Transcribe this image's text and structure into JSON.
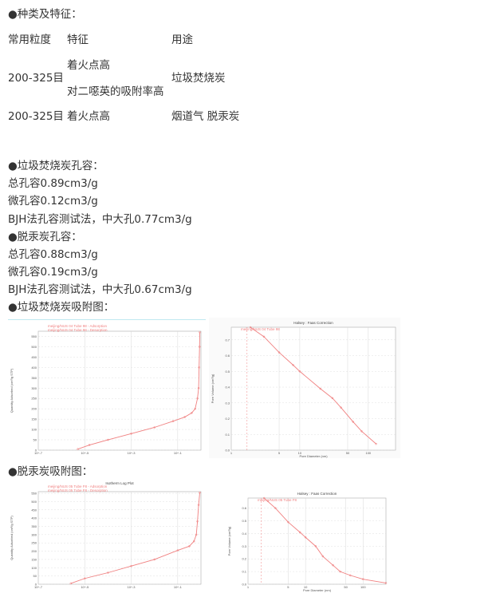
{
  "heading_types": "●种类及特征：",
  "table": {
    "headers": [
      "常用粒度",
      "特征",
      "用途"
    ],
    "rows": [
      {
        "size": "200-325目",
        "features": [
          "着火点高",
          "对二噁英的吸附率高"
        ],
        "use": "垃圾焚烧炭"
      },
      {
        "size": "200-325目",
        "features": [
          "着火点高"
        ],
        "use": "烟道气 脱汞炭"
      }
    ]
  },
  "section1": {
    "title": "●垃圾焚烧炭孔容：",
    "lines": [
      "总孔容0.89cm3/g",
      "微孔容0.12cm3/g",
      "BJH法孔容测试法，中大孔0.77cm3/g"
    ]
  },
  "section2": {
    "title": "●脱汞炭孔容：",
    "lines": [
      "总孔容0.88cm3/g",
      "微孔容0.19cm3/g",
      "BJH法孔容测试法，中大孔0.67cm3/g"
    ]
  },
  "heading_fig1": "●垃圾焚烧炭吸附图：",
  "heading_fig2": "●脱汞炭吸附图：",
  "colors": {
    "series": "#f08080",
    "grid": "#d8d8d8",
    "text": "#333333"
  },
  "figures": {
    "fig1_isotherm": {
      "type": "line",
      "legend": [
        "meijing/NUS 04 Tube 98 - Adsorption",
        "meijing/NUS 04 Tube 98 - Desorption"
      ],
      "ylabel": "Quantity Adsorbed (cm³/g STP)",
      "ylim": [
        0,
        575
      ],
      "yticks": [
        "0",
        "50",
        "100",
        "150",
        "200",
        "250",
        "300",
        "350",
        "400",
        "450",
        "500",
        "550"
      ],
      "xscale": "log",
      "xlim": [
        -7,
        0
      ],
      "points": [
        [
          -5.3,
          5
        ],
        [
          -4.8,
          25
        ],
        [
          -4,
          50
        ],
        [
          -3,
          80
        ],
        [
          -2,
          110
        ],
        [
          -1.2,
          140
        ],
        [
          -0.7,
          160
        ],
        [
          -0.4,
          180
        ],
        [
          -0.25,
          200
        ],
        [
          -0.15,
          250
        ],
        [
          -0.1,
          300
        ],
        [
          -0.08,
          400
        ],
        [
          -0.06,
          500
        ],
        [
          -0.05,
          570
        ]
      ]
    },
    "fig1_bjh": {
      "type": "line",
      "title": "Halsey : Faas Correction",
      "legend": [
        "meijing/NUS 04 Tube 98"
      ],
      "xlabel": "Pore Diameter (nm)",
      "ylabel": "Pore Volume (cm³/g)",
      "ylim": [
        0,
        0.78
      ],
      "yticks": [
        "0.0",
        "0.1",
        "0.2",
        "0.3",
        "0.4",
        "0.5",
        "0.6",
        "0.7"
      ],
      "xticks": [
        "1",
        "5",
        "10",
        "50",
        "100"
      ],
      "xscale": "log",
      "points": [
        [
          1.9,
          0.78
        ],
        [
          3,
          0.72
        ],
        [
          5,
          0.62
        ],
        [
          8,
          0.54
        ],
        [
          10,
          0.5
        ],
        [
          20,
          0.39
        ],
        [
          30,
          0.33
        ],
        [
          40,
          0.27
        ],
        [
          60,
          0.18
        ],
        [
          80,
          0.12
        ],
        [
          130,
          0.04
        ]
      ]
    },
    "fig2_isotherm": {
      "type": "line",
      "title": "Isotherm Log Plot",
      "legend": [
        "meijing/NUS 05 Tube F8 - Adsorption",
        "meijing/NUS 05 Tube F8 - Desorption"
      ],
      "ylabel": "Quantity Adsorbed (cm³/g STP)",
      "ylim": [
        0,
        560
      ],
      "yticks": [
        "0",
        "50",
        "100",
        "150",
        "200",
        "250",
        "300",
        "350",
        "400",
        "450",
        "500",
        "550"
      ],
      "xscale": "log",
      "xlim": [
        -7,
        0
      ],
      "points": [
        [
          -5.6,
          5
        ],
        [
          -5,
          35
        ],
        [
          -4,
          70
        ],
        [
          -3,
          110
        ],
        [
          -2,
          150
        ],
        [
          -1,
          205
        ],
        [
          -0.5,
          230
        ],
        [
          -0.3,
          260
        ],
        [
          -0.2,
          300
        ],
        [
          -0.15,
          380
        ],
        [
          -0.1,
          480
        ],
        [
          -0.05,
          555
        ]
      ]
    },
    "fig2_bjh": {
      "type": "line",
      "title": "Halsey : Faas Correction",
      "legend": [
        "meijing/NUS 05 Tube F8"
      ],
      "xlabel": "Pore Diameter (nm)",
      "ylabel": "Pore Volume (cm³/g)",
      "ylim": [
        0,
        0.68
      ],
      "yticks": [
        "0.0",
        "0.1",
        "0.2",
        "0.3",
        "0.4",
        "0.5",
        "0.6"
      ],
      "xticks": [
        "1",
        "5",
        "10",
        "50",
        "100"
      ],
      "xscale": "log",
      "points": [
        [
          1.9,
          0.68
        ],
        [
          3,
          0.6
        ],
        [
          5,
          0.49
        ],
        [
          8,
          0.41
        ],
        [
          10,
          0.37
        ],
        [
          15,
          0.3
        ],
        [
          20,
          0.22
        ],
        [
          30,
          0.15
        ],
        [
          40,
          0.1
        ],
        [
          60,
          0.07
        ],
        [
          100,
          0.04
        ],
        [
          250,
          0.01
        ]
      ]
    }
  }
}
